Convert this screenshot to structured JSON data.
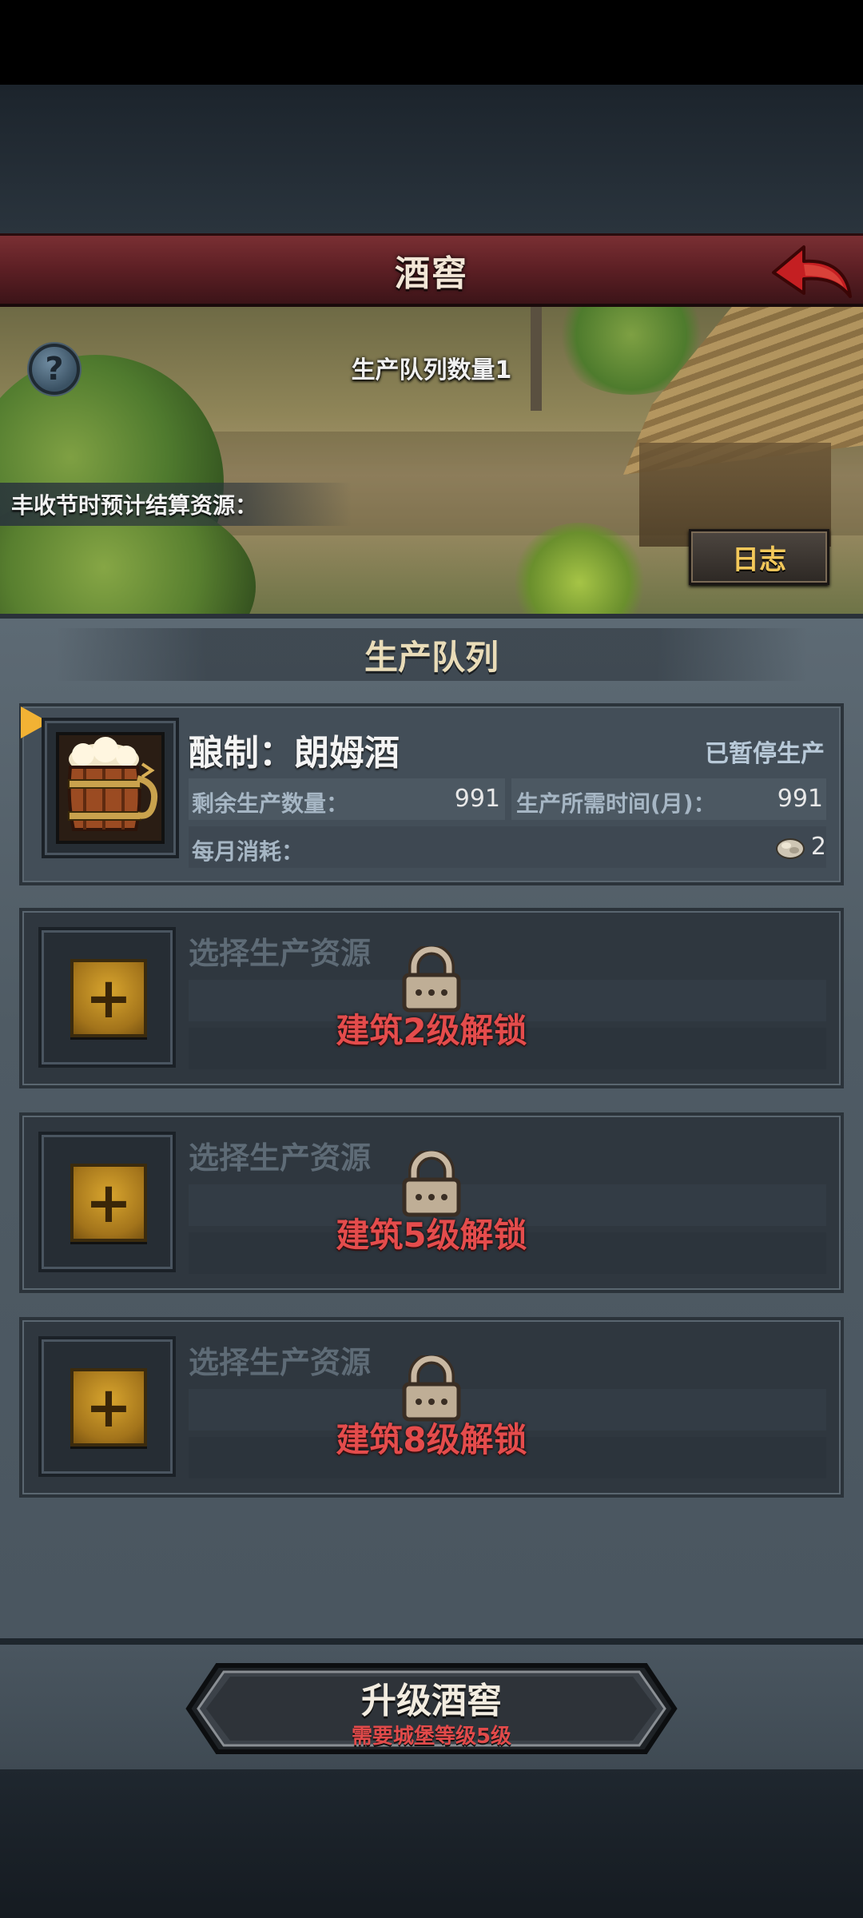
{
  "header": {
    "title": "酒窖"
  },
  "banner": {
    "queue_count_text": "生产队列数量1",
    "harvest_text": "丰收节时预计结算资源：",
    "log_button": "日志"
  },
  "production": {
    "section_title": "生产队列",
    "active": {
      "title": "酿制：朗姆酒",
      "status": "已暂停生产",
      "remaining_label": "剩余生产数量：",
      "remaining_value": "991",
      "time_label": "生产所需时间(月)：",
      "time_value": "991",
      "monthly_label": "每月消耗：",
      "monthly_value": "2"
    },
    "locked_slots": [
      {
        "title": "选择生产资源",
        "unlock": "建筑2级解锁",
        "plus": "+"
      },
      {
        "title": "选择生产资源",
        "unlock": "建筑5级解锁",
        "plus": "+"
      },
      {
        "title": "选择生产资源",
        "unlock": "建筑8级解锁",
        "plus": "+"
      }
    ]
  },
  "upgrade": {
    "label": "升级酒窖",
    "requirement": "需要城堡等级5级"
  },
  "icons": {
    "back": "back-arrow-icon",
    "help": "help-icon",
    "barrel": "beer-barrel-icon",
    "lock": "padlock-icon",
    "coin": "resource-coin-icon"
  },
  "colors": {
    "accent_gold": "#f2b234",
    "unlock_red": "#e44c4c",
    "header_red": "#7a2f33"
  }
}
